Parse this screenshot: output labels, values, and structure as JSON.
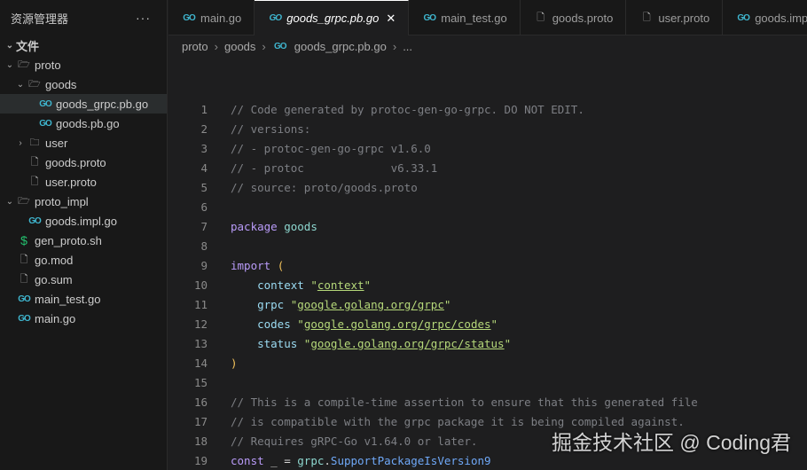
{
  "explorer": {
    "title": "资源管理器",
    "more": "···",
    "items": [
      {
        "label": "文件",
        "icon": "chevron",
        "type": "root",
        "depth": 0,
        "chev": "⌄"
      },
      {
        "label": "proto",
        "icon": "folder-open",
        "type": "folder",
        "depth": 0,
        "chev": "⌄"
      },
      {
        "label": "goods",
        "icon": "folder-open",
        "type": "folder",
        "depth": 1,
        "chev": "⌄"
      },
      {
        "label": "goods_grpc.pb.go",
        "icon": "go",
        "type": "go",
        "depth": 2,
        "selected": true
      },
      {
        "label": "goods.pb.go",
        "icon": "go",
        "type": "go",
        "depth": 2
      },
      {
        "label": "user",
        "icon": "folder",
        "type": "folder",
        "depth": 1,
        "chev": "›"
      },
      {
        "label": "goods.proto",
        "icon": "file",
        "type": "file",
        "depth": 1
      },
      {
        "label": "user.proto",
        "icon": "file",
        "type": "file",
        "depth": 1
      },
      {
        "label": "proto_impl",
        "icon": "folder-open",
        "type": "folder",
        "depth": 0,
        "chev": "⌄"
      },
      {
        "label": "goods.impl.go",
        "icon": "go",
        "type": "go",
        "depth": 1
      },
      {
        "label": "gen_proto.sh",
        "icon": "shell",
        "type": "sh",
        "depth": 0
      },
      {
        "label": "go.mod",
        "icon": "file",
        "type": "file",
        "depth": 0
      },
      {
        "label": "go.sum",
        "icon": "file",
        "type": "file",
        "depth": 0
      },
      {
        "label": "main_test.go",
        "icon": "go",
        "type": "go",
        "depth": 0
      },
      {
        "label": "main.go",
        "icon": "go",
        "type": "go",
        "depth": 0
      }
    ]
  },
  "tabs": [
    {
      "label": "main.go",
      "type": "go"
    },
    {
      "label": "goods_grpc.pb.go",
      "type": "go",
      "active": true
    },
    {
      "label": "main_test.go",
      "type": "go"
    },
    {
      "label": "goods.proto",
      "type": "file"
    },
    {
      "label": "user.proto",
      "type": "file"
    },
    {
      "label": "goods.impl.go",
      "type": "go"
    }
  ],
  "breadcrumb": [
    "proto",
    "goods",
    "goods_grpc.pb.go",
    "..."
  ],
  "code": [
    [
      [
        "comment",
        "// Code generated by protoc-gen-go-grpc. DO NOT EDIT."
      ]
    ],
    [
      [
        "comment",
        "// versions:"
      ]
    ],
    [
      [
        "comment",
        "// - protoc-gen-go-grpc v1.6.0"
      ]
    ],
    [
      [
        "comment",
        "// - protoc             v6.33.1"
      ]
    ],
    [
      [
        "comment",
        "// source: proto/goods.proto"
      ]
    ],
    [],
    [
      [
        "kw",
        "package"
      ],
      [
        "plain",
        " "
      ],
      [
        "pkg",
        "goods"
      ]
    ],
    [],
    [
      [
        "kw",
        "import"
      ],
      [
        "plain",
        " "
      ],
      [
        "paren",
        "("
      ]
    ],
    [
      [
        "plain",
        "    "
      ],
      [
        "id",
        "context"
      ],
      [
        "plain",
        " "
      ],
      [
        "str",
        "\""
      ],
      [
        "strl",
        "context"
      ],
      [
        "str",
        "\""
      ]
    ],
    [
      [
        "plain",
        "    "
      ],
      [
        "id",
        "grpc"
      ],
      [
        "plain",
        " "
      ],
      [
        "str",
        "\""
      ],
      [
        "strl",
        "google.golang.org/grpc"
      ],
      [
        "str",
        "\""
      ]
    ],
    [
      [
        "plain",
        "    "
      ],
      [
        "id",
        "codes"
      ],
      [
        "plain",
        " "
      ],
      [
        "str",
        "\""
      ],
      [
        "strl",
        "google.golang.org/grpc/codes"
      ],
      [
        "str",
        "\""
      ]
    ],
    [
      [
        "plain",
        "    "
      ],
      [
        "id",
        "status"
      ],
      [
        "plain",
        " "
      ],
      [
        "str",
        "\""
      ],
      [
        "strl",
        "google.golang.org/grpc/status"
      ],
      [
        "str",
        "\""
      ]
    ],
    [
      [
        "paren",
        ")"
      ]
    ],
    [],
    [
      [
        "comment",
        "// This is a compile-time assertion to ensure that this generated file"
      ]
    ],
    [
      [
        "comment",
        "// is compatible with the grpc package it is being compiled against."
      ]
    ],
    [
      [
        "comment",
        "// Requires gRPC-Go v1.64.0 or later."
      ]
    ],
    [
      [
        "kw",
        "const"
      ],
      [
        "plain",
        " _ = "
      ],
      [
        "pkg",
        "grpc"
      ],
      [
        "plain",
        "."
      ],
      [
        "fn",
        "SupportPackageIsVersion9"
      ]
    ]
  ],
  "watermark": "掘金技术社区 @ Coding君"
}
